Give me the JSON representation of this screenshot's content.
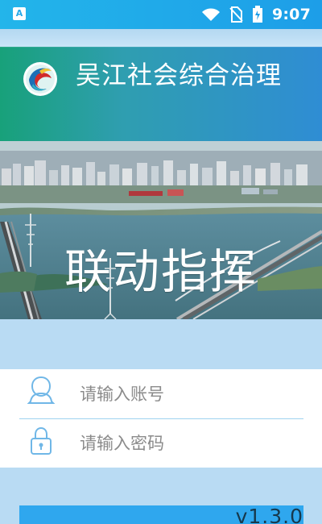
{
  "status_bar": {
    "left_icon_label": "A",
    "time": "9:07",
    "icons": [
      "wifi-icon",
      "no-sim-icon",
      "battery-icon"
    ]
  },
  "header": {
    "title": "吴江社会综合治理"
  },
  "hero": {
    "slogan": "联动指挥"
  },
  "login": {
    "account_placeholder": "请输入账号",
    "password_placeholder": "请输入密码"
  },
  "footer": {
    "version": "v1.3.0"
  },
  "colors": {
    "status_bar": "#1d9ee8",
    "banner_start": "#18a17a",
    "banner_end": "#2f8dd4",
    "page_bg": "#b9dbf3",
    "field_bg": "#ffffff",
    "accent": "#2fa7ee"
  }
}
